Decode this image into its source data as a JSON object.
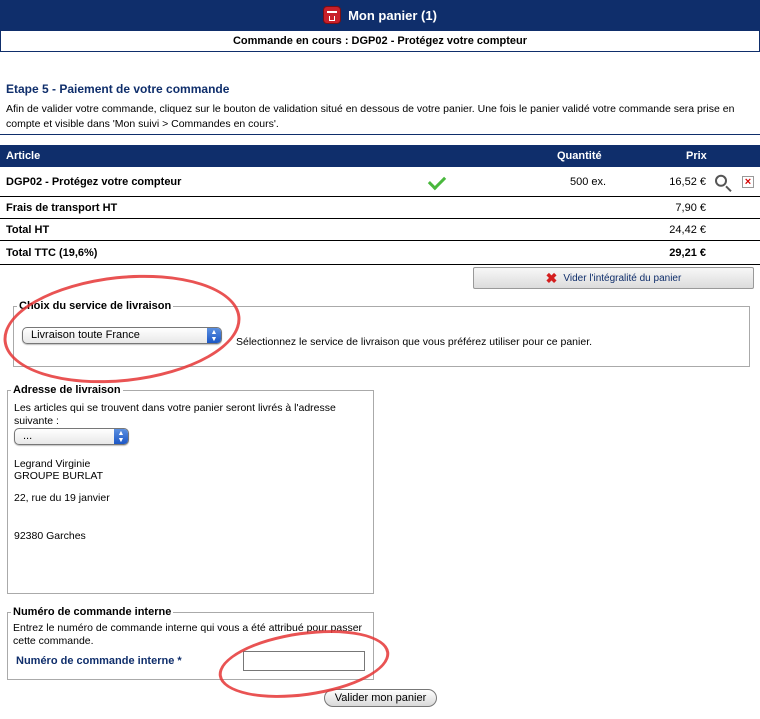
{
  "header": {
    "title": "Mon panier (1)",
    "order_line": "Commande en cours : DGP02 - Protégez votre compteur"
  },
  "step": {
    "title": "Etape 5 - Paiement de votre commande",
    "text": "Afin de valider votre commande, cliquez sur le bouton de validation situé en dessous de votre panier. Une fois le panier validé votre commande sera prise en compte et visible dans 'Mon suivi > Commandes en cours'."
  },
  "table": {
    "headers": {
      "article": "Article",
      "quantity": "Quantité",
      "price": "Prix"
    },
    "item": {
      "name": "DGP02 - Protégez votre compteur",
      "quantity": "500 ex.",
      "price": "16,52 €"
    },
    "shipping": {
      "label": "Frais de transport HT",
      "price": "7,90 €"
    },
    "total_ht": {
      "label": "Total HT",
      "price": "24,42 €"
    },
    "total_ttc": {
      "label": "Total TTC (19,6%)",
      "price": "29,21 €"
    }
  },
  "empty_cart_label": "Vider l'intégralité du panier",
  "delivery_service": {
    "legend": "Choix du service de livraison",
    "selected": "Livraison toute France",
    "hint": "Sélectionnez le service de livraison que vous préférez utiliser pour ce panier."
  },
  "delivery_address": {
    "legend": "Adresse de livraison",
    "intro": "Les articles qui se trouvent dans votre panier seront livrés à l'adresse suivante :",
    "selected": "...",
    "name": "Legrand Virginie",
    "company": "GROUPE BURLAT",
    "street": "22, rue du 19 janvier",
    "city": "92380 Garches"
  },
  "internal_order": {
    "legend": "Numéro de commande interne",
    "text": "Entrez le numéro de commande interne qui vous a été attribué pour passer cette commande.",
    "label": "Numéro de commande interne *",
    "value": ""
  },
  "validate_label": "Valider mon panier",
  "colors": {
    "navy": "#0f2e6b",
    "annotation": "#e53535",
    "check": "#49b83d"
  },
  "icons": [
    "cart-icon",
    "check-icon",
    "zoom-icon",
    "delete-icon",
    "x-icon"
  ]
}
